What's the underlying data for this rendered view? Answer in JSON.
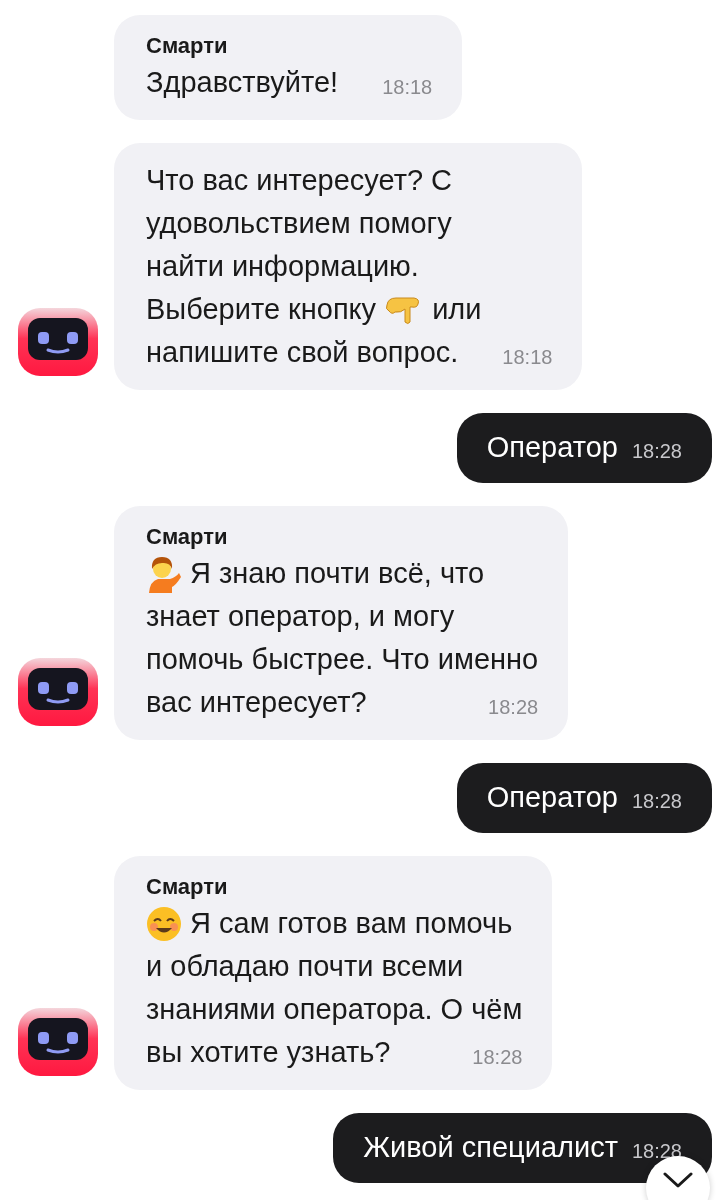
{
  "messages": [
    {
      "kind": "bot",
      "sender": "Смарти",
      "lines": [
        [
          {
            "kind": "text",
            "text": "Здравствуйте!"
          }
        ]
      ],
      "time": "18:18",
      "avatar": false
    },
    {
      "kind": "bot",
      "lines": [
        [
          {
            "kind": "text",
            "text": "Что вас интересует? С"
          }
        ],
        [
          {
            "kind": "text",
            "text": "удовольствием помогу"
          }
        ],
        [
          {
            "kind": "text",
            "text": "найти информацию."
          }
        ],
        [
          {
            "kind": "text",
            "text": "Выберите кнопку"
          },
          {
            "kind": "pointing-emoji"
          },
          {
            "kind": "text",
            "text": "или"
          }
        ],
        [
          {
            "kind": "text",
            "text": "напишите свой вопрос."
          }
        ]
      ],
      "time": "18:18",
      "avatar": true
    },
    {
      "kind": "user",
      "text": "Оператор",
      "time": "18:28"
    },
    {
      "kind": "bot",
      "sender": "Смарти",
      "lines": [
        [
          {
            "kind": "person-emoji"
          },
          {
            "kind": "text",
            "text": "Я знаю почти всё, что"
          }
        ],
        [
          {
            "kind": "text",
            "text": "знает оператор, и могу"
          }
        ],
        [
          {
            "kind": "text",
            "text": "помочь быстрее. Что именно"
          }
        ],
        [
          {
            "kind": "text",
            "text": "вас интересует?"
          }
        ]
      ],
      "time": "18:28",
      "avatar": true
    },
    {
      "kind": "user",
      "text": "Оператор",
      "time": "18:28"
    },
    {
      "kind": "bot",
      "sender": "Смарти",
      "lines": [
        [
          {
            "kind": "smiling-emoji"
          },
          {
            "kind": "text",
            "text": "Я сам готов вам помочь"
          }
        ],
        [
          {
            "kind": "text",
            "text": "и обладаю почти всеми"
          }
        ],
        [
          {
            "kind": "text",
            "text": "знаниями оператора. О чём"
          }
        ],
        [
          {
            "kind": "text",
            "text": "вы хотите узнать?"
          }
        ]
      ],
      "time": "18:28",
      "avatar": true
    },
    {
      "kind": "user",
      "text": "Живой специалист",
      "time": "18:28"
    }
  ]
}
